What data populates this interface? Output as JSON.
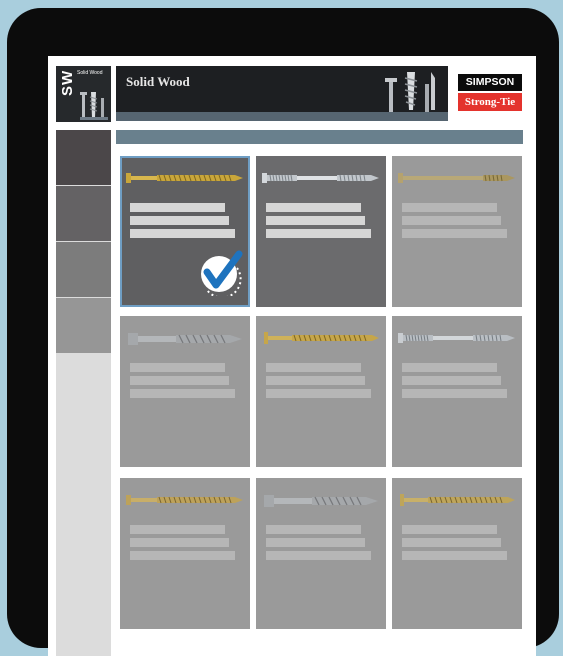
{
  "header": {
    "logo_mark": "SW",
    "logo_subtitle": "Solid Wood",
    "title": "Solid Wood",
    "brand_top": "SIMPSON",
    "brand_bottom": "Strong-Tie"
  },
  "colors": {
    "background": "#a9cedd",
    "device": "#0c0c0c",
    "banner": "#1d1f22",
    "accent_bar": "#69808d",
    "brand_red": "#e4332d",
    "selected_outline": "#6f9ec4",
    "check_blue": "#1e73be"
  },
  "sidebar": {
    "tabs": [
      {
        "color": "#4b4749"
      },
      {
        "color": "#646264"
      },
      {
        "color": "#7c7c7c"
      },
      {
        "color": "#969696"
      }
    ]
  },
  "products": [
    {
      "screw": "gold-torx-screw",
      "selected": true
    },
    {
      "screw": "silver-long-screw",
      "selected": false
    },
    {
      "screw": "bronze-long-screw",
      "selected": false
    },
    {
      "screw": "gray-hex-lag-screw",
      "selected": false
    },
    {
      "screw": "gold-washer-screw",
      "selected": false
    },
    {
      "screw": "silver-long-screw",
      "selected": false
    },
    {
      "screw": "gold-torx-screw",
      "selected": false
    },
    {
      "screw": "gray-hex-lag-screw",
      "selected": false
    },
    {
      "screw": "gold-washer-screw",
      "selected": false
    }
  ],
  "icons": {
    "check": "checkmark-badge-icon"
  }
}
